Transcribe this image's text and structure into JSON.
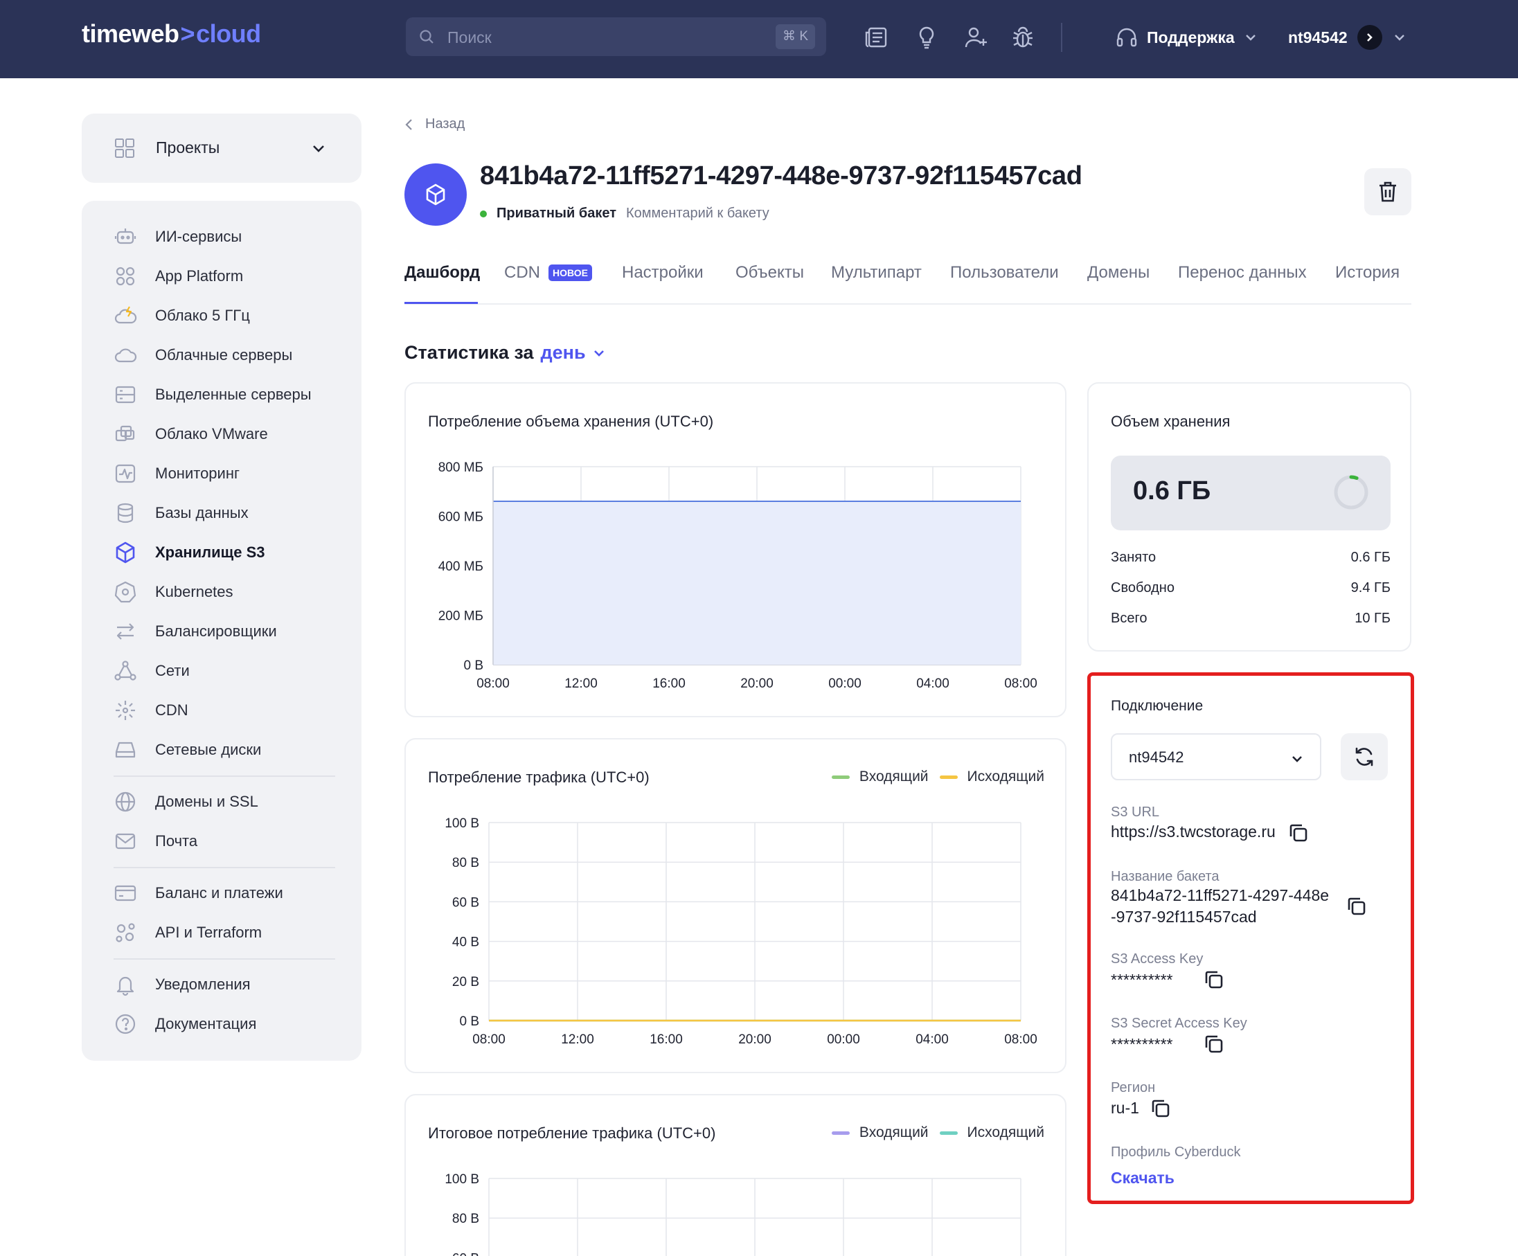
{
  "topbar": {
    "logo_main": "timeweb",
    "logo_chevron": ">",
    "logo_accent": "cloud",
    "search_placeholder": "Поиск",
    "search_shortcut": "⌘ K",
    "support_label": "Поддержка",
    "username": "nt94542",
    "icons": [
      "news-icon",
      "lightbulb-icon",
      "add-user-icon",
      "bug-icon",
      "headset-icon"
    ]
  },
  "sidebar": {
    "projects_label": "Проекты",
    "groups": [
      [
        {
          "label": "ИИ-сервисы",
          "icon": "ai-robot-icon"
        },
        {
          "label": "App Platform",
          "icon": "app-platform-icon"
        },
        {
          "label": "Облако 5 ГГц",
          "icon": "cloud-bolt-icon"
        },
        {
          "label": "Облачные серверы",
          "icon": "cloud-icon"
        },
        {
          "label": "Выделенные серверы",
          "icon": "server-icon"
        },
        {
          "label": "Облако VMware",
          "icon": "vmware-icon"
        },
        {
          "label": "Мониторинг",
          "icon": "monitoring-icon"
        },
        {
          "label": "Базы данных",
          "icon": "database-icon"
        },
        {
          "label": "Хранилище S3",
          "icon": "s3-cube-icon",
          "active": true
        },
        {
          "label": "Kubernetes",
          "icon": "kubernetes-icon"
        },
        {
          "label": "Балансировщики",
          "icon": "balancer-arrows-icon"
        },
        {
          "label": "Сети",
          "icon": "network-icon"
        },
        {
          "label": "CDN",
          "icon": "cdn-icon"
        },
        {
          "label": "Сетевые диски",
          "icon": "disk-icon"
        }
      ],
      [
        {
          "label": "Домены и SSL",
          "icon": "globe-icon"
        },
        {
          "label": "Почта",
          "icon": "mail-icon"
        }
      ],
      [
        {
          "label": "Баланс и платежи",
          "icon": "card-icon"
        },
        {
          "label": "API и Terraform",
          "icon": "api-icon"
        }
      ],
      [
        {
          "label": "Уведомления",
          "icon": "bell-icon"
        },
        {
          "label": "Документация",
          "icon": "help-icon"
        }
      ]
    ]
  },
  "header": {
    "back_label": "Назад",
    "bucket_name": "841b4a72-11ff5271-4297-448e-9737-92f115457cad",
    "bucket_type": "Приватный бакет",
    "comment_link": "Комментарий к бакету"
  },
  "tabs": [
    {
      "label": "Дашборд",
      "active": true
    },
    {
      "label": "CDN",
      "badge": "НОВОЕ"
    },
    {
      "label": "Настройки"
    },
    {
      "label": "Объекты"
    },
    {
      "label": "Мультипарт"
    },
    {
      "label": "Пользователи"
    },
    {
      "label": "Домены"
    },
    {
      "label": "Перенос данных"
    },
    {
      "label": "История"
    }
  ],
  "stats": {
    "title": "Статистика за",
    "period": "день"
  },
  "chart_data": [
    {
      "type": "area",
      "title": "Потребление объема хранения (UTC+0)",
      "x": [
        "08:00",
        "12:00",
        "16:00",
        "20:00",
        "00:00",
        "04:00",
        "08:00"
      ],
      "y_ticks": [
        "0 В",
        "200 МБ",
        "400 МБ",
        "600 МБ",
        "800 МБ"
      ],
      "ylim": [
        0,
        800
      ],
      "series": [
        {
          "values": [
            660,
            660,
            660,
            660,
            660,
            660,
            660
          ]
        }
      ],
      "colors": {
        "line": "#5b7fe0",
        "fill": "#e8edfb"
      },
      "grid": true
    },
    {
      "type": "line",
      "title": "Потребление трафика (UTC+0)",
      "x": [
        "08:00",
        "12:00",
        "16:00",
        "20:00",
        "00:00",
        "04:00",
        "08:00"
      ],
      "y_ticks": [
        "0 В",
        "20 В",
        "40 В",
        "60 В",
        "80 В",
        "100 В"
      ],
      "ylim": [
        0,
        100
      ],
      "series": [
        {
          "name": "Входящий",
          "color": "#8fcc7a",
          "values": [
            0,
            0,
            0,
            0,
            0,
            0,
            0
          ]
        },
        {
          "name": "Исходящий",
          "color": "#f5c542",
          "values": [
            0,
            0,
            0,
            0,
            0,
            0,
            0
          ]
        }
      ],
      "legend": "top-right",
      "grid": true
    },
    {
      "type": "line",
      "title": "Итоговое потребление трафика (UTC+0)",
      "y_ticks": [
        "60 В",
        "80 В",
        "100 В"
      ],
      "ylim": [
        0,
        100
      ],
      "series": [
        {
          "name": "Входящий",
          "color": "#a79ced"
        },
        {
          "name": "Исходящий",
          "color": "#6fd0c2"
        }
      ],
      "legend": "top-right",
      "grid": true
    }
  ],
  "storage": {
    "title": "Объем хранения",
    "value": "0.6 ГБ",
    "used_fraction": 0.06,
    "rows": [
      {
        "label": "Занято",
        "value": "0.6 ГБ"
      },
      {
        "label": "Свободно",
        "value": "9.4 ГБ"
      },
      {
        "label": "Всего",
        "value": "10 ГБ"
      }
    ]
  },
  "connection": {
    "title": "Подключение",
    "selected_user": "nt94542",
    "s3_url_label": "S3 URL",
    "s3_url": "https://s3.twcstorage.ru",
    "bucket_name_label": "Название бакета",
    "bucket_name_line1": "841b4a72-11ff5271-4297-448e",
    "bucket_name_line2": "-9737-92f115457cad",
    "access_key_label": "S3 Access Key",
    "access_key": "**********",
    "secret_key_label": "S3 Secret Access Key",
    "secret_key": "**********",
    "region_label": "Регион",
    "region": "ru-1",
    "cyberduck_label": "Профиль Cyberduck",
    "download_label": "Скачать"
  },
  "colors": {
    "topbar": "#2b3357",
    "accent": "#4f55ef",
    "highlight_border": "#e41e1e"
  }
}
